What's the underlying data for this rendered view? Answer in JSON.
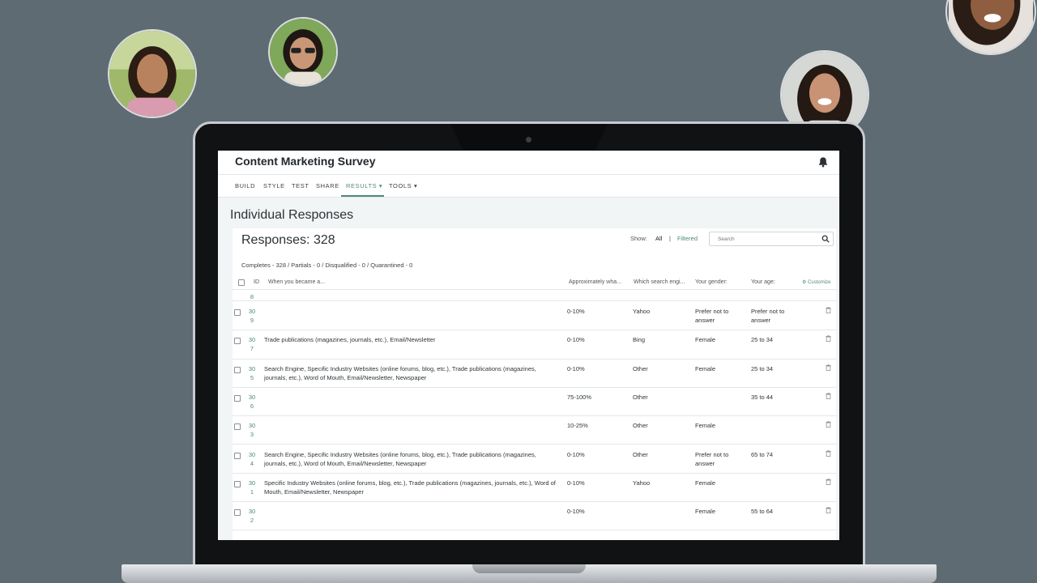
{
  "app": {
    "title": "Content Marketing Survey"
  },
  "nav": [
    {
      "label": "BUILD",
      "active": false
    },
    {
      "label": "STYLE",
      "active": false
    },
    {
      "label": "TEST",
      "active": false
    },
    {
      "label": "SHARE",
      "active": false
    },
    {
      "label": "RESULTS ▾",
      "active": true
    },
    {
      "label": "TOOLS ▾",
      "active": false
    }
  ],
  "page": {
    "title": "Individual Responses"
  },
  "responses": {
    "title": "Responses: 328",
    "summary": "Completes - 328 / Partials - 0 / Disqualified - 0 / Quarantined - 0",
    "show_label": "Show:",
    "show_all": "All",
    "show_separator": "|",
    "show_filtered": "Filtered",
    "search_placeholder": "Search"
  },
  "table": {
    "headers": {
      "id": "ID",
      "q1": "When you became a...",
      "q2": "Approximately wha...",
      "q3": "Which search engi...",
      "q4": "Your gender:",
      "q5": "Your age:",
      "customize": "⚙ Customize"
    },
    "partial_row_id": "8",
    "rows": [
      {
        "id": "309",
        "q1": "",
        "q2": "0-10%",
        "q3": "Yahoo",
        "q4": "Prefer not to answer",
        "q5": "Prefer not to answer"
      },
      {
        "id": "307",
        "q1": "Trade publications (magazines, journals, etc.), Email/Newsletter",
        "q2": "0-10%",
        "q3": "Bing",
        "q4": "Female",
        "q5": "25 to 34"
      },
      {
        "id": "305",
        "q1": "Search Engine, Specific Industry Websites (online forums, blog, etc.), Trade publications (magazines, journals, etc.), Word of Mouth, Email/Newsletter, Newspaper",
        "q2": "0-10%",
        "q3": "Other",
        "q4": "Female",
        "q5": "25 to 34"
      },
      {
        "id": "306",
        "q1": "",
        "q2": "75-100%",
        "q3": "Other",
        "q4": "",
        "q5": "35 to 44"
      },
      {
        "id": "303",
        "q1": "",
        "q2": "10-25%",
        "q3": "Other",
        "q4": "Female",
        "q5": ""
      },
      {
        "id": "304",
        "q1": "Search Engine, Specific Industry Websites (online forums, blog, etc.), Trade publications (magazines, journals, etc.), Word of Mouth, Email/Newsletter, Newspaper",
        "q2": "0-10%",
        "q3": "Other",
        "q4": "Prefer not to answer",
        "q5": "65 to 74"
      },
      {
        "id": "301",
        "q1": "Specific Industry Websites (online forums, blog, etc.), Trade publications (magazines, journals, etc.), Word of Mouth, Email/Newsletter, Newspaper",
        "q2": "0-10%",
        "q3": "Yahoo",
        "q4": "Female",
        "q5": ""
      },
      {
        "id": "302",
        "q1": "",
        "q2": "0-10%",
        "q3": "",
        "q4": "Female",
        "q5": "55 to 64"
      }
    ]
  },
  "colors": {
    "accent": "#4d8a79",
    "background": "#5f6b72"
  },
  "icons": {
    "bell": "bell-icon",
    "search": "search-icon",
    "delete": "trash-icon",
    "settings": "gear-icon"
  }
}
